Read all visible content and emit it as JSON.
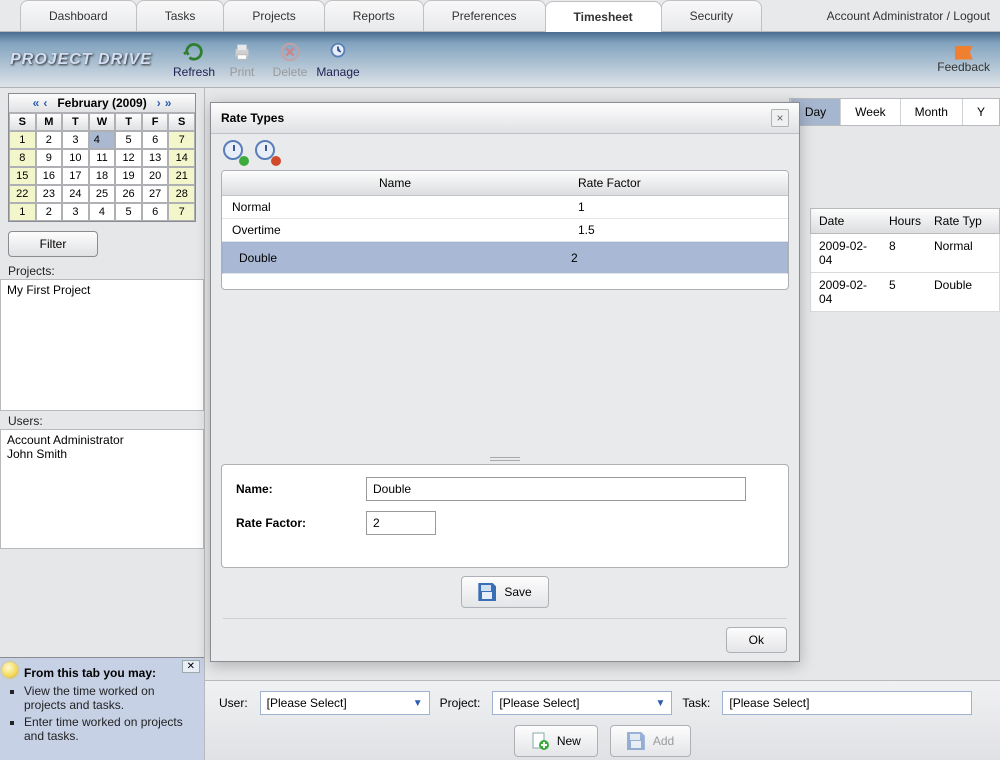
{
  "tabs": [
    "Dashboard",
    "Tasks",
    "Projects",
    "Reports",
    "Preferences",
    "Timesheet",
    "Security"
  ],
  "active_tab": "Timesheet",
  "user_link": "Account Administrator / Logout",
  "logo": "PROJECT DRIVE",
  "toolbar": {
    "refresh": "Refresh",
    "print": "Print",
    "delete": "Delete",
    "manage": "Manage"
  },
  "feedback": "Feedback",
  "calendar": {
    "title": "February (2009)",
    "days": [
      "S",
      "M",
      "T",
      "W",
      "T",
      "F",
      "S"
    ],
    "rows": [
      [
        1,
        2,
        3,
        4,
        5,
        6,
        7
      ],
      [
        8,
        9,
        10,
        11,
        12,
        13,
        14
      ],
      [
        15,
        16,
        17,
        18,
        19,
        20,
        21
      ],
      [
        22,
        23,
        24,
        25,
        26,
        27,
        28
      ],
      [
        1,
        2,
        3,
        4,
        5,
        6,
        7
      ]
    ],
    "selected": 4
  },
  "filter": "Filter",
  "projects_label": "Projects:",
  "projects": [
    "My First Project"
  ],
  "users_label": "Users:",
  "users": [
    "Account Administrator",
    "John Smith"
  ],
  "tips": {
    "title": "From this tab you may:",
    "items": [
      "View the time worked on projects and tasks.",
      "Enter time worked on projects and tasks."
    ]
  },
  "views": {
    "day": "Day",
    "week": "Week",
    "month": "Month",
    "year": "Y"
  },
  "ts_headers": {
    "date": "Date",
    "hours": "Hours",
    "rate": "Rate Typ"
  },
  "ts_rows": [
    {
      "date": "2009-02-04",
      "hours": "8",
      "rate": "Normal"
    },
    {
      "date": "2009-02-04",
      "hours": "5",
      "rate": "Double"
    }
  ],
  "bottom": {
    "user": "User:",
    "project": "Project:",
    "task": "Task:",
    "placeholder": "[Please Select]",
    "new": "New",
    "add": "Add"
  },
  "modal": {
    "title": "Rate Types",
    "cols": {
      "name": "Name",
      "factor": "Rate Factor"
    },
    "rows": [
      {
        "name": "Normal",
        "factor": "1"
      },
      {
        "name": "Overtime",
        "factor": "1.5"
      },
      {
        "name": "Double",
        "factor": "2"
      }
    ],
    "selected": 2,
    "form": {
      "name_label": "Name:",
      "factor_label": "Rate Factor:",
      "name_value": "Double",
      "factor_value": "2"
    },
    "save": "Save",
    "ok": "Ok"
  }
}
